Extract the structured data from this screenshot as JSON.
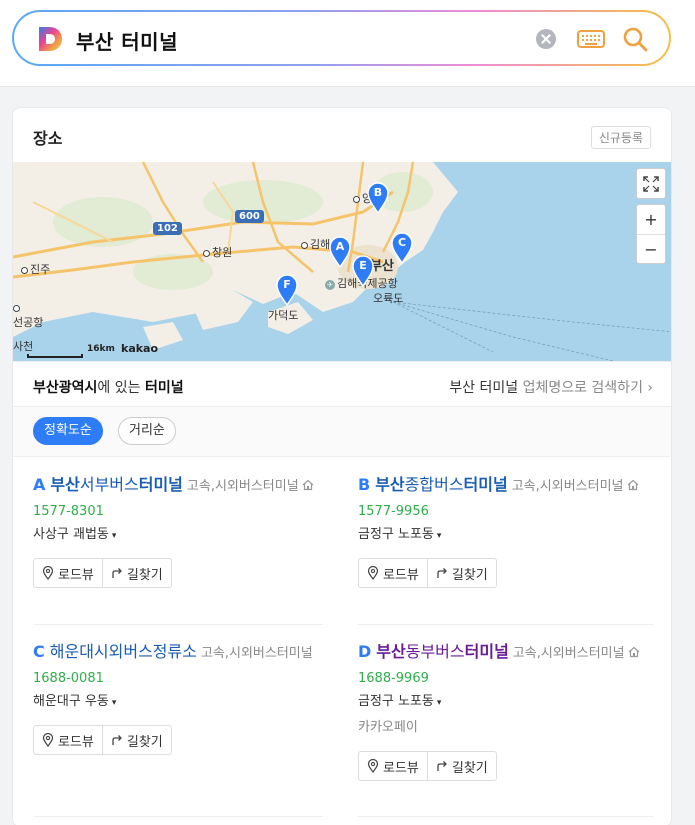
{
  "search": {
    "query": "부산 터미널"
  },
  "place_card": {
    "title": "장소",
    "register_label": "신규등록"
  },
  "map": {
    "labels": {
      "yangsan": "양산",
      "gimhae": "김해",
      "changwon": "창원",
      "jinju": "진주",
      "busan": "부산",
      "airport": "김해국제공항",
      "gadeokdo": "가덕도",
      "oryukdo": "오륙도",
      "port": "선공항",
      "sacheon": "사천"
    },
    "road_signs": [
      "102",
      "600"
    ],
    "markers": [
      "A",
      "B",
      "C",
      "E",
      "F"
    ],
    "scale_label": "16km",
    "brand": "kakao",
    "zoom_in": "+",
    "zoom_out": "−"
  },
  "region": {
    "area": "부산광역시",
    "middle": "에 있는 ",
    "category": "터미널",
    "search_query": "부산 터미널",
    "search_suffix": " 업체명으로 검색하기 ›"
  },
  "sort": {
    "accuracy": "정확도순",
    "distance": "거리순"
  },
  "buttons": {
    "roadview": "로드뷰",
    "directions": "길찾기"
  },
  "results": [
    {
      "letter": "A",
      "prefix": "부산",
      "middle": "서부버스",
      "suffix": "터미널",
      "category": "고속,시외버스터미널",
      "phone": "1577-8301",
      "address": "사상구 괘법동",
      "caret": "▾",
      "pay": ""
    },
    {
      "letter": "B",
      "prefix": "부산",
      "middle": "종합버스",
      "suffix": "터미널",
      "category": "고속,시외버스터미널",
      "phone": "1577-9956",
      "address": "금정구 노포동",
      "caret": "▾",
      "pay": ""
    },
    {
      "letter": "C",
      "prefix": "",
      "middle": "해운대시외버스정류소",
      "suffix": "",
      "category": "고속,시외버스터미널",
      "phone": "1688-0081",
      "address": "해운대구 우동",
      "caret": "▾",
      "pay": ""
    },
    {
      "letter": "D",
      "prefix": "부산",
      "middle": "동부버스",
      "suffix": "터미널",
      "category": "고속,시외버스터미널",
      "phone": "1688-9969",
      "address": "금정구 노포동",
      "caret": "▾",
      "pay": "카카오페이"
    }
  ],
  "colors": {
    "accent": "#2e7cf6",
    "phone": "#2fae4b",
    "link": "#1a5db3",
    "visited": "#6a1b9a",
    "sea": "#a9d3ea"
  }
}
